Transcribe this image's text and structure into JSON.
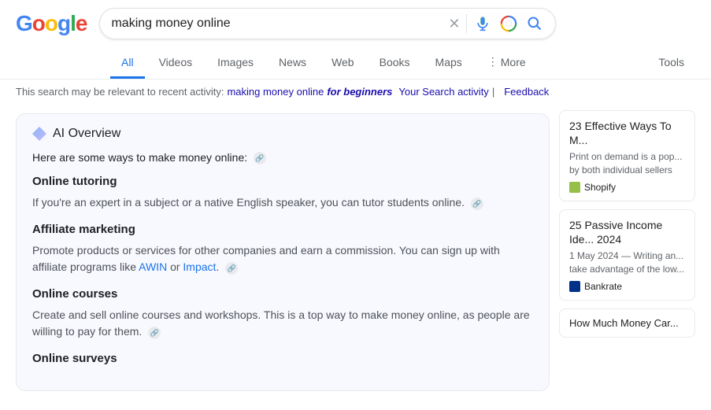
{
  "header": {
    "logo": {
      "text": "Google",
      "letters": [
        "G",
        "o",
        "o",
        "g",
        "l",
        "e"
      ]
    },
    "search": {
      "value": "making money online",
      "placeholder": "making money online"
    }
  },
  "nav": {
    "tabs": [
      {
        "label": "All",
        "active": true
      },
      {
        "label": "Videos",
        "active": false
      },
      {
        "label": "Images",
        "active": false
      },
      {
        "label": "News",
        "active": false
      },
      {
        "label": "Web",
        "active": false
      },
      {
        "label": "Books",
        "active": false
      },
      {
        "label": "Maps",
        "active": false
      },
      {
        "label": "More",
        "active": false
      }
    ],
    "tools_label": "Tools"
  },
  "recent_bar": {
    "prefix": "This search may be relevant to recent activity:",
    "link_text": "making money online",
    "bold_link_text": "for beginners",
    "activity_label": "Your Search activity",
    "feedback_label": "Feedback",
    "separator": "|"
  },
  "ai_overview": {
    "icon_label": "ai-diamond-icon",
    "title": "AI Overview",
    "intro": "Here are some ways to make money online:",
    "items": [
      {
        "heading": "Online tutoring",
        "text": "If you're an expert in a subject or a native English speaker, you can tutor students online."
      },
      {
        "heading": "Affiliate marketing",
        "text": "Promote products or services for other companies and earn a commission. You can sign up with affiliate programs like AWIN or Impact."
      },
      {
        "heading": "Online courses",
        "text": "Create and sell online courses and workshops. This is a top way to make money online, as people are willing to pay for them."
      },
      {
        "heading": "Online surveys",
        "text": ""
      }
    ]
  },
  "right_cards": [
    {
      "title": "23 Effective Ways To M...",
      "desc": "Print on demand is a pop... by both individual sellers",
      "source_name": "Shopify",
      "source_color": "shopify"
    },
    {
      "title": "25 Passive Income Ide... 2024",
      "desc": "1 May 2024 — Writing an... take advantage of the low...",
      "source_name": "Bankrate",
      "source_color": "bankrate"
    },
    {
      "title": "How Much Money Car...",
      "desc": "",
      "source_name": "",
      "source_color": ""
    }
  ]
}
